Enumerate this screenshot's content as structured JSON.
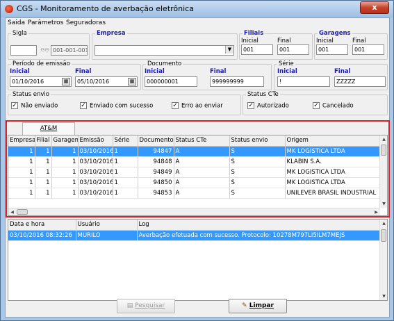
{
  "window": {
    "title": "CGS - Monitoramento de averbação eletrônica",
    "close_label": "x"
  },
  "menu": [
    "Saida",
    "Parâmetros",
    "Seguradoras"
  ],
  "filters": {
    "sigla": {
      "label": "Sigla",
      "value": "",
      "code": "001-001-001"
    },
    "empresa": {
      "label": "Empresa",
      "value": ""
    },
    "filiais": {
      "label": "Filiais",
      "inicial_label": "Inicial",
      "final_label": "Final",
      "inicial": "001",
      "final": "001"
    },
    "garagens": {
      "label": "Garagens",
      "inicial_label": "Inicial",
      "final_label": "Final",
      "inicial": "001",
      "final": "001"
    },
    "periodo": {
      "label": "Período de emissão",
      "inicial_label": "Inicial",
      "final_label": "Final",
      "inicial": "01/10/2016",
      "final": "05/10/2016"
    },
    "documento": {
      "label": "Documento",
      "inicial_label": "Inicial",
      "final_label": "Final",
      "inicial": "000000001",
      "final": "999999999"
    },
    "serie": {
      "label": "Série",
      "inicial_label": "Inicial",
      "final_label": "Final",
      "inicial": "!",
      "final": "ZZZZZ"
    },
    "status_envio": {
      "label": "Status envio",
      "options": [
        "Não enviado",
        "Enviado com sucesso",
        "Erro ao enviar"
      ]
    },
    "status_cte": {
      "label": "Status CTe",
      "options": [
        "Autorizado",
        "Cancelado"
      ]
    }
  },
  "tab": "AT&M",
  "grid": {
    "columns": [
      "Empresa",
      "Filial",
      "Garagem",
      "Emissão",
      "Série",
      "Documento",
      "Status CTe",
      "Status envio",
      "Origem"
    ],
    "rows": [
      [
        "1",
        "1",
        "1",
        "03/10/2016",
        "1",
        "94847",
        "A",
        "S",
        "MK LOGISTICA LTDA"
      ],
      [
        "1",
        "1",
        "1",
        "03/10/2016",
        "1",
        "94848",
        "A",
        "S",
        "KLABIN S.A."
      ],
      [
        "1",
        "1",
        "1",
        "03/10/2016",
        "1",
        "94849",
        "A",
        "S",
        "MK LOGISTICA LTDA"
      ],
      [
        "1",
        "1",
        "1",
        "03/10/2016",
        "1",
        "94850",
        "A",
        "S",
        "MK LOGISTICA LTDA"
      ],
      [
        "1",
        "1",
        "1",
        "03/10/2016",
        "1",
        "94853",
        "A",
        "S",
        "UNILEVER BRASIL INDUSTRIAL"
      ]
    ],
    "selected_row": 0
  },
  "log": {
    "columns": [
      "Data e hora",
      "Usuário",
      "Log"
    ],
    "rows": [
      [
        "03/10/2016 08:32:26",
        "MURILO",
        "Averbação efetuada com sucesso. Protocolo: 10278M797LI5ILM7MEJS"
      ]
    ]
  },
  "buttons": {
    "pesquisar": "Pesquisar",
    "limpar": "Limpar"
  },
  "colors": {
    "selection": "#3399ff",
    "highlight_border": "#d9232e",
    "group_title": "#1a1ab3"
  }
}
